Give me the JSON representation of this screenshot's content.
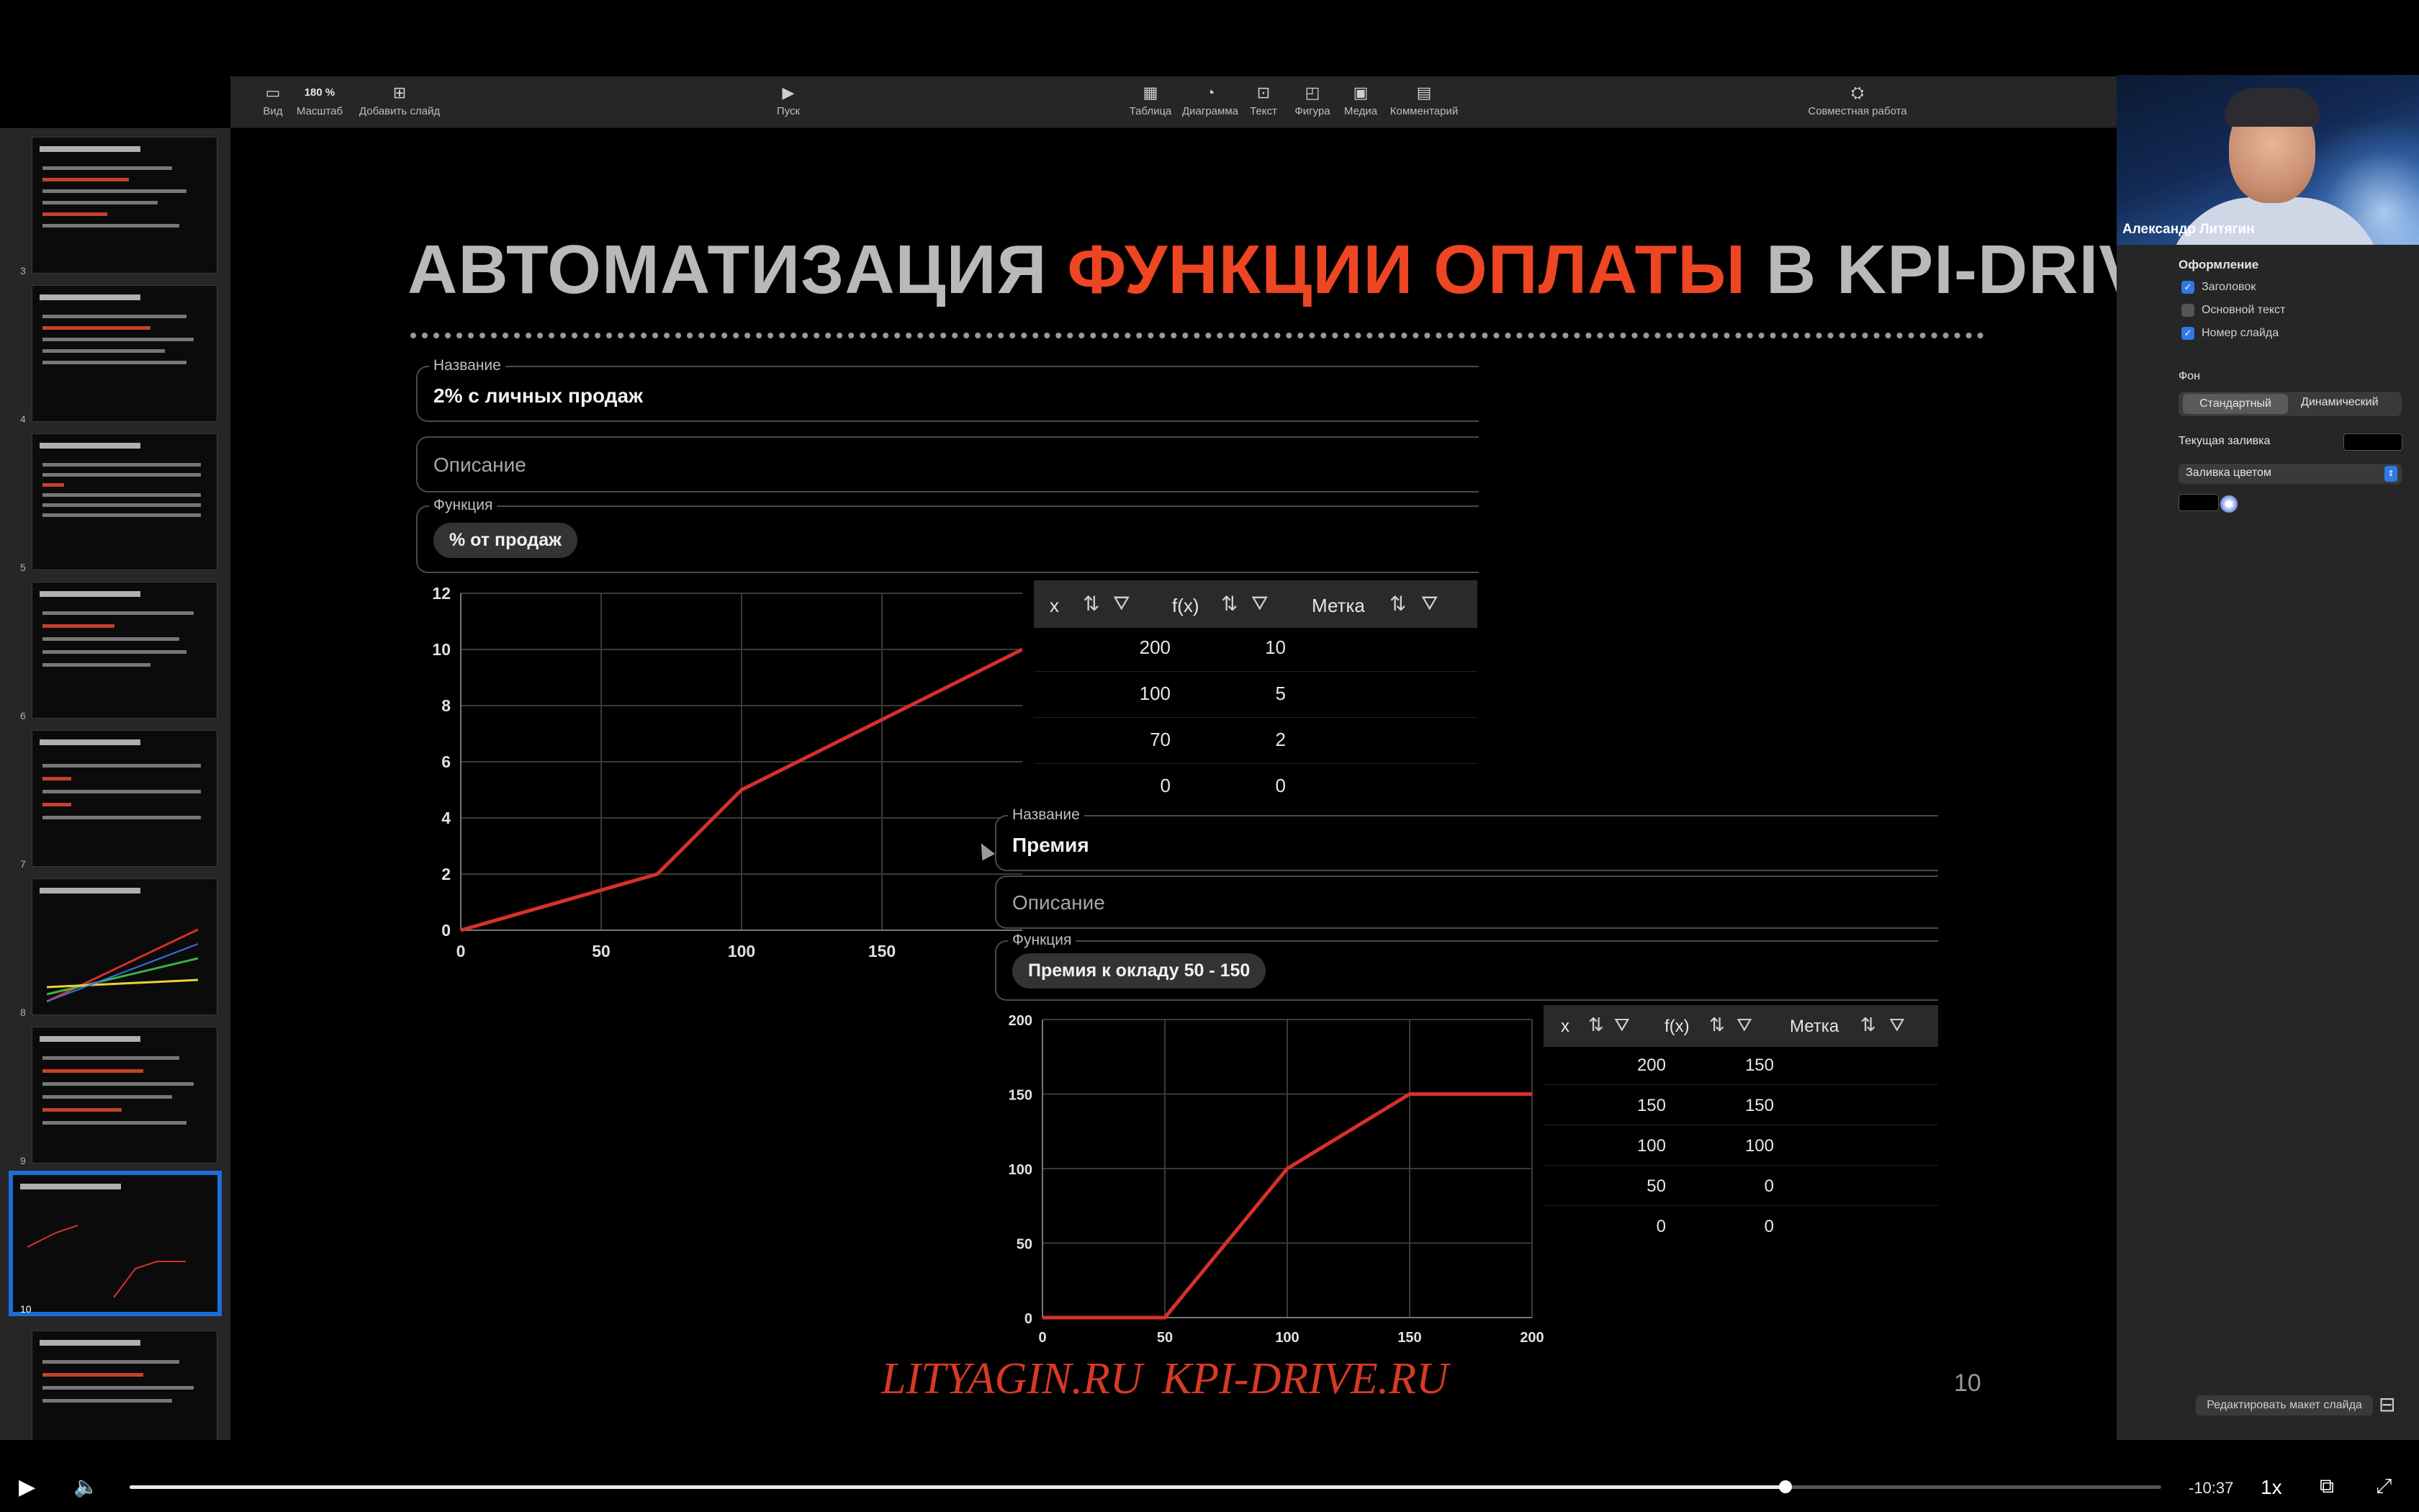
{
  "toolbar": {
    "zoom_value": "180 %",
    "items": [
      {
        "label": "Вид",
        "icon": "sidebar-icon"
      },
      {
        "label": "Масштаб",
        "icon": "zoom-icon"
      },
      {
        "label": "Добавить слайд",
        "icon": "add-slide-icon"
      },
      {
        "label": "Пуск",
        "icon": "play-icon"
      },
      {
        "label": "Таблица",
        "icon": "table-icon"
      },
      {
        "label": "Диаграмма",
        "icon": "chart-icon"
      },
      {
        "label": "Текст",
        "icon": "text-icon"
      },
      {
        "label": "Фигура",
        "icon": "shape-icon"
      },
      {
        "label": "Медиа",
        "icon": "media-icon"
      },
      {
        "label": "Комментарий",
        "icon": "comment-icon"
      },
      {
        "label": "Совместная работа",
        "icon": "collaborate-icon"
      }
    ]
  },
  "thumbnails": {
    "numbers": [
      "3",
      "4",
      "5",
      "6",
      "7",
      "8",
      "9",
      "10"
    ],
    "active": "10"
  },
  "slide": {
    "title_part1": "АВТОМАТИЗАЦИЯ ",
    "title_accent": "ФУНКЦИИ ОПЛАТЫ",
    "title_part2": " В KPI-DRIVE",
    "footer_links": "LITYAGIN.RU KPI-DRIVE.RU",
    "slide_number": "10",
    "card1": {
      "name_label": "Название",
      "name_value": "2% с личных продаж",
      "desc_placeholder": "Описание",
      "func_label": "Функция",
      "func_chip": "% от продаж",
      "table_headers": [
        "x",
        "f(x)",
        "Метка"
      ],
      "table_rows": [
        [
          "200",
          "10"
        ],
        [
          "100",
          "5"
        ],
        [
          "70",
          "2"
        ],
        [
          "0",
          "0"
        ]
      ]
    },
    "card2": {
      "name_label": "Название",
      "name_value": "Премия",
      "desc_placeholder": "Описание",
      "func_label": "Функция",
      "func_chip": "Премия к окладу 50 - 150",
      "table_headers": [
        "x",
        "f(x)",
        "Метка"
      ],
      "table_rows": [
        [
          "200",
          "150"
        ],
        [
          "150",
          "150"
        ],
        [
          "100",
          "100"
        ],
        [
          "50",
          "0"
        ],
        [
          "0",
          "0"
        ]
      ]
    }
  },
  "chart_data": [
    {
      "type": "line",
      "x": [
        0,
        70,
        100,
        200
      ],
      "series": [
        {
          "values": [
            0,
            2,
            5,
            10
          ],
          "color": "#d8302a"
        }
      ],
      "xticks": [
        0,
        50,
        100,
        150
      ],
      "yticks": [
        0,
        2,
        4,
        6,
        8,
        10,
        12
      ],
      "xlim": [
        0,
        200
      ],
      "ylim": [
        0,
        12
      ],
      "grid": true
    },
    {
      "type": "line",
      "x": [
        0,
        50,
        100,
        150,
        200
      ],
      "series": [
        {
          "values": [
            0,
            0,
            100,
            150,
            150
          ],
          "color": "#d8302a"
        }
      ],
      "xticks": [
        0,
        50,
        100,
        150,
        200
      ],
      "yticks": [
        0,
        50,
        100,
        150,
        200
      ],
      "xlim": [
        0,
        200
      ],
      "ylim": [
        0,
        200
      ],
      "grid": true
    }
  ],
  "inspector": {
    "section_title": "Оформление",
    "checkboxes": [
      {
        "label": "Заголовок",
        "checked": true
      },
      {
        "label": "Основной текст",
        "checked": false
      },
      {
        "label": "Номер слайда",
        "checked": true
      }
    ],
    "bg_title": "Фон",
    "bg_standard": "Стандартный",
    "bg_dynamic": "Динамический",
    "current_fill": "Текущая заливка",
    "fill_type": "Заливка цветом",
    "edit_layout": "Редактировать макет слайда"
  },
  "webcam": {
    "name": "Александр Литягин"
  },
  "player": {
    "progress": 0.815,
    "time_remaining": "-10:37",
    "rate": "1x"
  },
  "colors": {
    "accent": "#ee4523",
    "line": "#d8302a",
    "selection": "#1a6fd6"
  }
}
